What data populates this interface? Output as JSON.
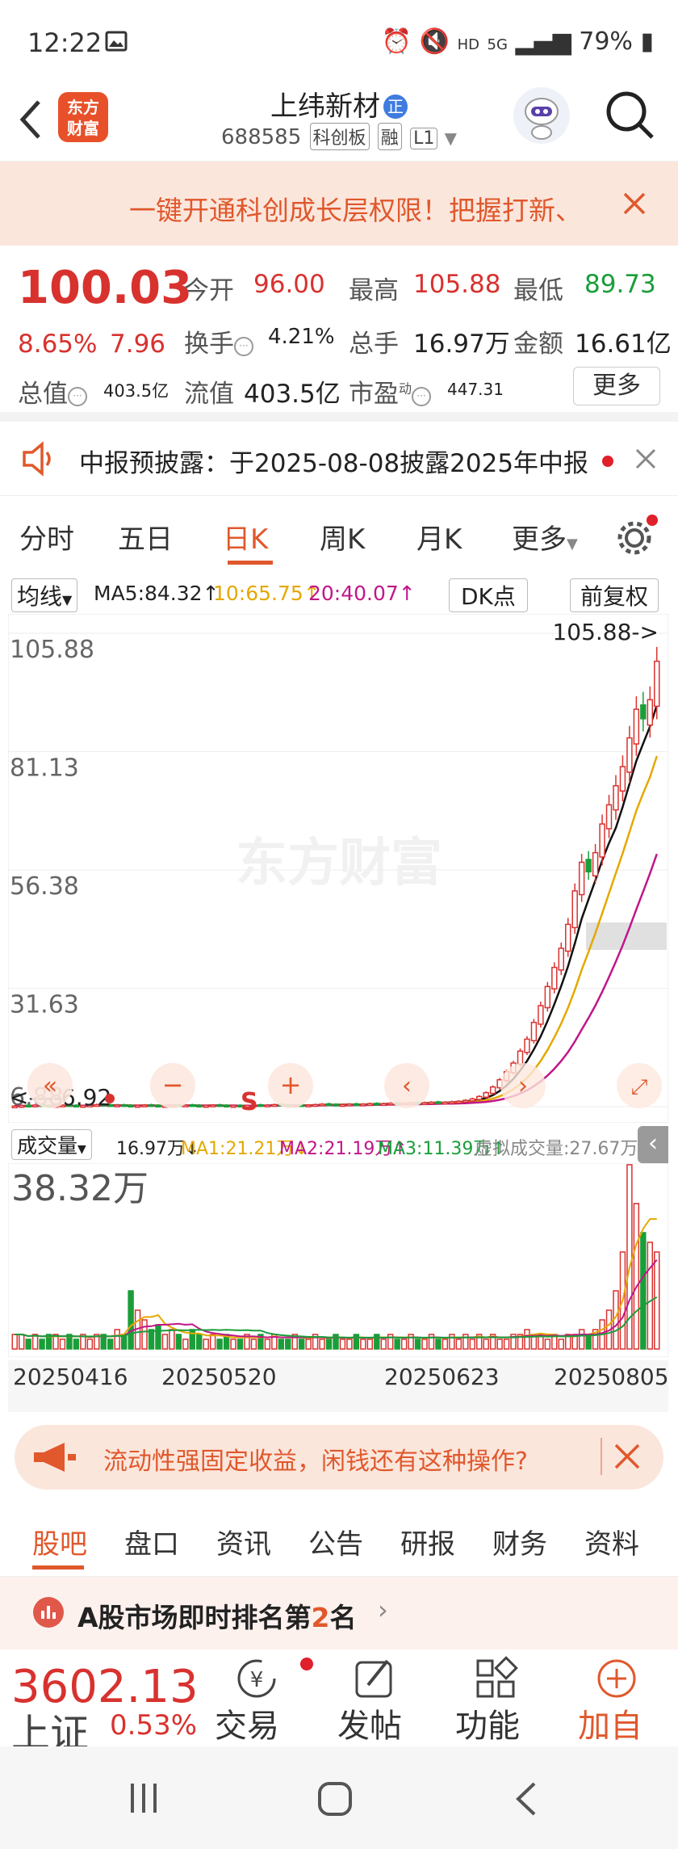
{
  "status": {
    "time": "12:22",
    "battery": "79%",
    "network": "5G",
    "hd": "HD"
  },
  "header": {
    "logo": "东方财富",
    "stock_name": "上纬新材",
    "badge": "正",
    "code": "688585",
    "tags": [
      "科创板",
      "融",
      "L1"
    ]
  },
  "promo": {
    "text": "一键开通科创成长层权限！把握打新、"
  },
  "quote": {
    "price": "100.03",
    "change_pct": "8.65%",
    "change": "7.96",
    "open_label": "今开",
    "open": "96.00",
    "high_label": "最高",
    "high": "105.88",
    "low_label": "最低",
    "low": "89.73",
    "turnover_label": "换手",
    "turnover": "4.21%",
    "volume_label": "总手",
    "volume": "16.97万",
    "amount_label": "金额",
    "amount": "16.61亿",
    "mcap_label": "总值",
    "mcap": "403.5亿",
    "float_label": "流值",
    "float_cap": "403.5亿",
    "pe_label": "市盈",
    "pe_sup": "动",
    "pe": "447.31",
    "more": "更多"
  },
  "notice": {
    "text": "中报预披露：于2025-08-08披露2025年中报"
  },
  "periods": {
    "tabs": [
      "分时",
      "五日",
      "日K",
      "周K",
      "月K",
      "更多"
    ],
    "active": "日K"
  },
  "ma": {
    "selector": "均线",
    "ma5": "MA5:84.32↑",
    "ma10": "10:65.75↑",
    "ma20": "20:40.07↑",
    "dk": "DK点",
    "adjust": "前复权",
    "ma10_color": "#e5a800",
    "ma20_color": "#c0168a"
  },
  "chart_data": {
    "type": "candlestick",
    "y_ticks": [
      "105.88",
      "81.13",
      "56.38",
      "31.63",
      "6.88"
    ],
    "y_range": [
      6.88,
      105.88
    ],
    "high_marker": "105.88->",
    "low_marker": "<----6.92",
    "watermark": "东方财富",
    "x_ticks": [
      "20250416",
      "20250520",
      "20250623",
      "20250805"
    ],
    "signal": "S",
    "closes": [
      7.0,
      7.1,
      7.0,
      7.2,
      7.1,
      7.0,
      7.1,
      7.2,
      7.1,
      7.0,
      7.1,
      7.2,
      7.3,
      7.2,
      7.1,
      7.2,
      7.1,
      7.0,
      7.1,
      7.2,
      7.1,
      7.0,
      7.1,
      7.2,
      7.1,
      7.2,
      7.1,
      7.0,
      7.1,
      7.2,
      7.1,
      7.0,
      7.1,
      7.0,
      7.1,
      7.2,
      7.1,
      7.2,
      7.3,
      7.2,
      7.1,
      7.2,
      7.1,
      7.2,
      7.3,
      7.4,
      7.3,
      7.2,
      7.3,
      7.4,
      7.3,
      7.4,
      7.5,
      7.4,
      7.5,
      7.6,
      7.5,
      7.6,
      7.7,
      7.6,
      7.7,
      7.8,
      7.7,
      7.8,
      7.9,
      8.0,
      8.2,
      8.5,
      9.0,
      9.8,
      11.0,
      12.5,
      14.2,
      16.0,
      18.5,
      21.0,
      24.5,
      28.0,
      32.0,
      36.0,
      40.0,
      45.0,
      52.0,
      58.0,
      56.0,
      60.0,
      66.0,
      70.0,
      74.0,
      78.0,
      84.0,
      90.0,
      88.0,
      92.0,
      100.03
    ],
    "volume": {
      "label": "成交量",
      "value": "16.97万↓",
      "ma1": "MA1:21.21万↓",
      "ma2": "MA2:21.19万↑",
      "ma3": "MA3:11.39万↑",
      "virtual": "虚拟成交量:27.67万",
      "max_label": "38.32万",
      "bars": [
        3,
        3,
        2,
        3,
        2,
        3,
        3,
        2,
        3,
        2,
        3,
        2,
        3,
        3,
        2,
        4,
        3,
        12,
        8,
        6,
        4,
        5,
        3,
        4,
        3,
        2,
        4,
        3,
        2,
        3,
        2,
        3,
        2,
        2,
        3,
        2,
        3,
        2,
        3,
        2,
        2,
        3,
        2,
        2,
        3,
        2,
        2,
        3,
        2,
        2,
        3,
        2,
        2,
        3,
        2,
        3,
        2,
        2,
        3,
        2,
        2,
        3,
        2,
        2,
        3,
        2,
        3,
        2,
        3,
        2,
        3,
        2,
        2,
        3,
        3,
        4,
        3,
        3,
        2,
        3,
        2,
        3,
        3,
        4,
        3,
        4,
        6,
        8,
        12,
        20,
        38,
        30,
        24,
        22,
        20
      ]
    }
  },
  "ad": {
    "text": "流动性强固定收益，闲钱还有这种操作?"
  },
  "community_tabs": {
    "tabs": [
      "股吧",
      "盘口",
      "资讯",
      "公告",
      "研报",
      "财务",
      "资料"
    ],
    "active": "股吧"
  },
  "rank": {
    "text_pre": "A股市场即时排名第",
    "rank": "2",
    "text_post": "名"
  },
  "bottom": {
    "index_value": "3602.13",
    "index_name": "上证",
    "index_change": "0.53%",
    "items": [
      "交易",
      "发帖",
      "功能",
      "加自"
    ]
  },
  "colors": {
    "up": "#d8322f",
    "down": "#1a9e3a",
    "accent": "#e0582c"
  }
}
